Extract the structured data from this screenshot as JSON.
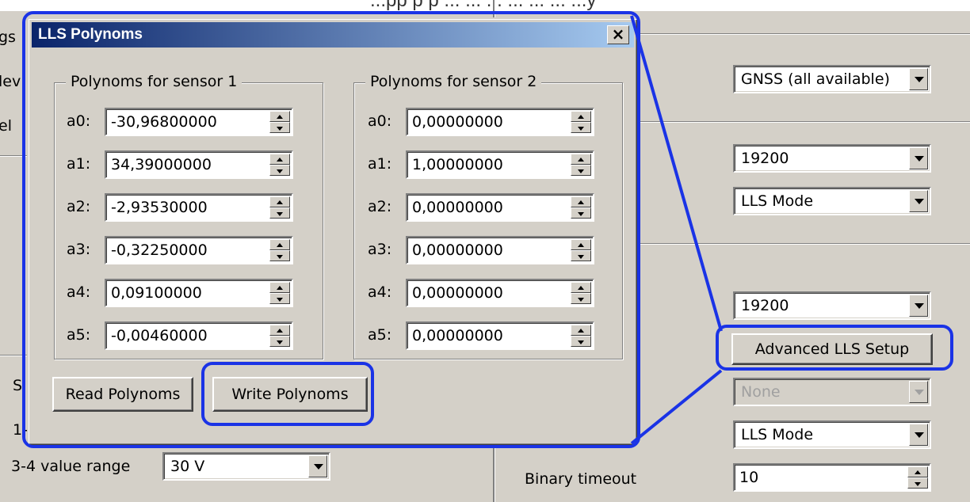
{
  "caption": "...pp p p ... ... ... ... ... ... ...y",
  "background": {
    "left_partial": [
      "gs",
      "lev",
      "el",
      "S",
      "1-"
    ],
    "value_range_label": "3-4 value range",
    "value_range_value": "30 V",
    "gnss_value": "GNSS (all available)",
    "baud1": "19200",
    "mode1": "LLS Mode",
    "baud2": "19200",
    "advanced_button": "Advanced LLS Setup",
    "none_value": "None",
    "mode2": "LLS Mode",
    "binary_timeout_label": "Binary timeout",
    "binary_timeout_value": "10"
  },
  "dialog": {
    "title": "LLS Polynoms",
    "close": "×",
    "group1": {
      "title": "Polynoms for sensor 1",
      "rows": [
        {
          "label": "a0:",
          "value": "-30,96800000"
        },
        {
          "label": "a1:",
          "value": "34,39000000"
        },
        {
          "label": "a2:",
          "value": "-2,93530000"
        },
        {
          "label": "a3:",
          "value": "-0,32250000"
        },
        {
          "label": "a4:",
          "value": "0,09100000"
        },
        {
          "label": "a5:",
          "value": "-0,00460000"
        }
      ]
    },
    "group2": {
      "title": "Polynoms for sensor 2",
      "rows": [
        {
          "label": "a0:",
          "value": "0,00000000"
        },
        {
          "label": "a1:",
          "value": "1,00000000"
        },
        {
          "label": "a2:",
          "value": "0,00000000"
        },
        {
          "label": "a3:",
          "value": "0,00000000"
        },
        {
          "label": "a4:",
          "value": "0,00000000"
        },
        {
          "label": "a5:",
          "value": "0,00000000"
        }
      ]
    },
    "read_button": "Read Polynoms",
    "write_button": "Write Polynoms"
  },
  "colors": {
    "highlight": "#1a33e6",
    "titlebar_start": "#0a246a",
    "titlebar_end": "#a6caf0",
    "face": "#d4d0c8"
  }
}
